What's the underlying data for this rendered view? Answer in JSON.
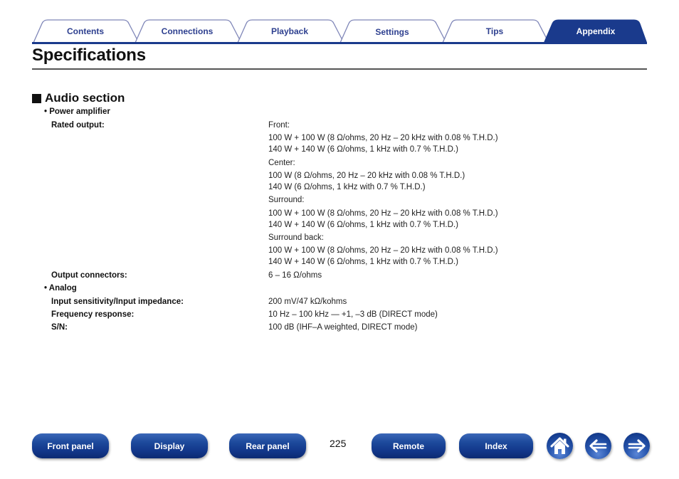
{
  "tabs": [
    {
      "label": "Contents",
      "active": false
    },
    {
      "label": "Connections",
      "active": false
    },
    {
      "label": "Playback",
      "active": false
    },
    {
      "label": "Settings",
      "active": false
    },
    {
      "label": "Tips",
      "active": false
    },
    {
      "label": "Appendix",
      "active": true
    }
  ],
  "colors": {
    "brand": "#1a3a8c",
    "tab_text": "#2d3f8f",
    "tab_border": "#7f86b8"
  },
  "page": {
    "title": "Specifications"
  },
  "section": {
    "title": "Audio section",
    "groups": [
      {
        "title": "Power amplifier",
        "rows": [
          {
            "label": "Rated output:",
            "values": [
              "Front:",
              "100 W + 100 W (8 Ω/ohms, 20 Hz – 20 kHz with 0.08 % T.H.D.)",
              "140 W + 140 W (6 Ω/ohms, 1 kHz with 0.7 % T.H.D.)",
              "Center:",
              "100 W (8 Ω/ohms, 20 Hz – 20 kHz with 0.08 % T.H.D.)",
              "140 W (6 Ω/ohms, 1 kHz with 0.7 % T.H.D.)",
              "Surround:",
              "100 W + 100 W (8 Ω/ohms, 20 Hz – 20 kHz with 0.08 % T.H.D.)",
              "140 W + 140 W (6 Ω/ohms, 1 kHz with 0.7 % T.H.D.)",
              "Surround back:",
              "100 W + 100 W (8 Ω/ohms, 20 Hz – 20 kHz with 0.08 % T.H.D.)",
              "140 W + 140 W (6 Ω/ohms, 1 kHz with 0.7 % T.H.D.)"
            ]
          },
          {
            "label": "Output connectors:",
            "values": [
              "6 – 16 Ω/ohms"
            ]
          }
        ]
      },
      {
        "title": "Analog",
        "rows": [
          {
            "label": "Input sensitivity/Input impedance:",
            "values": [
              "200 mV/47 kΩ/kohms"
            ]
          },
          {
            "label": "Frequency response:",
            "values": [
              "10 Hz – 100 kHz — +1, –3 dB (DIRECT mode)"
            ]
          },
          {
            "label": "S/N:",
            "values": [
              "100 dB (IHF–A weighted, DIRECT mode)"
            ]
          }
        ]
      }
    ]
  },
  "footer": {
    "buttons": [
      {
        "label": "Front panel"
      },
      {
        "label": "Display"
      },
      {
        "label": "Rear panel"
      },
      {
        "label": "Remote"
      },
      {
        "label": "Index"
      }
    ],
    "page_number": "225",
    "icons": {
      "home": "home-icon",
      "back": "arrow-left-icon",
      "forward": "arrow-right-icon"
    }
  }
}
